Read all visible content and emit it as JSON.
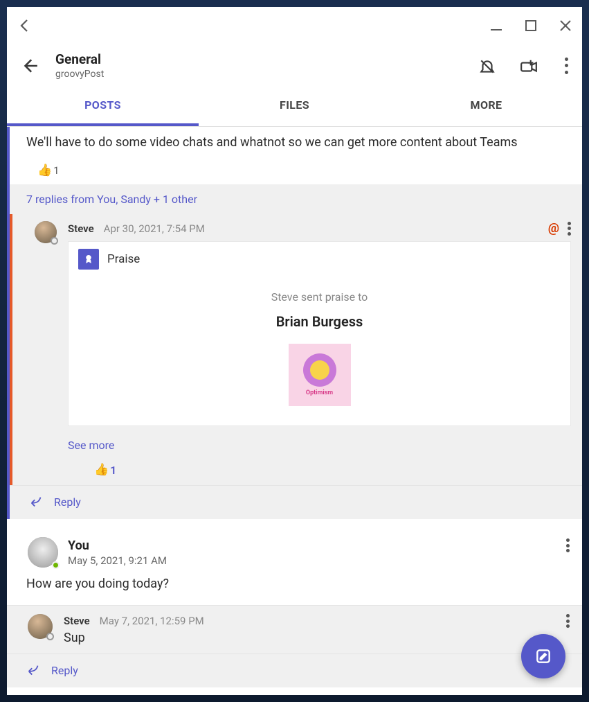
{
  "channel": {
    "title": "General",
    "subtitle": "groovyPost"
  },
  "tabs": {
    "posts": "POSTS",
    "files": "FILES",
    "more": "MORE"
  },
  "thread1": {
    "message": "We'll have to do some video chats and whatnot so we can get more content about Teams",
    "reaction_count": "1",
    "replies_summary": "7 replies from You, Sandy + 1 other",
    "reply": {
      "author": "Steve",
      "timestamp": "Apr 30, 2021, 7:54 PM",
      "praise_label": "Praise",
      "praise_sent": "Steve sent praise to",
      "praise_recipient": "Brian Burgess",
      "sticker_text": "Optimism",
      "see_more": "See more",
      "reaction_count": "1"
    },
    "reply_action": "Reply"
  },
  "thread2": {
    "post": {
      "author": "You",
      "timestamp": "May 5, 2021, 9:21 AM",
      "message": "How are you doing today?"
    },
    "reply": {
      "author": "Steve",
      "timestamp": "May 7, 2021, 12:59 PM",
      "message": "Sup"
    },
    "reply_action": "Reply"
  }
}
